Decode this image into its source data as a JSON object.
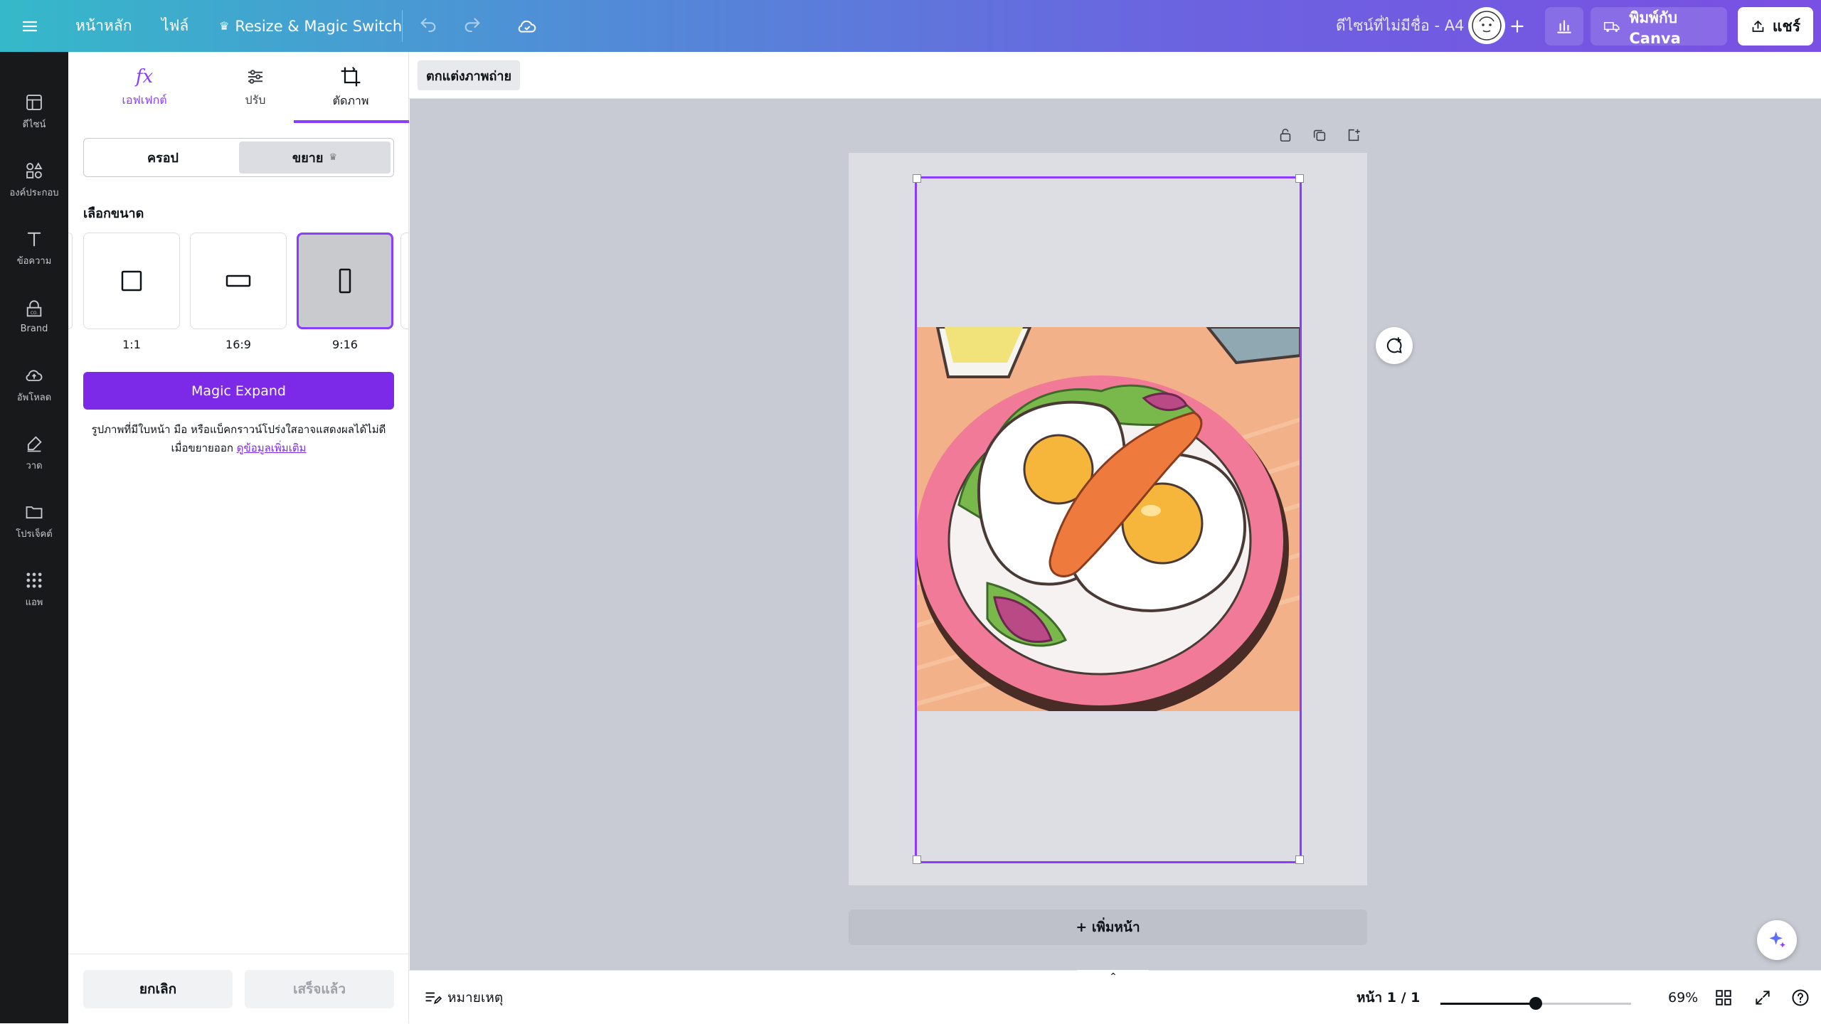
{
  "topbar": {
    "menu_icon": "hamburger-icon",
    "home": "หน้าหลัก",
    "file": "ไฟล์",
    "resize": "Resize & Magic Switch",
    "crown_icon": "crown-icon",
    "doc_title": "ดีไซน์ที่ไม่มีชื่อ - A4",
    "print": "พิมพ์กับ Canva",
    "share": "แชร์"
  },
  "rail": {
    "items": [
      {
        "label": "ดีไซน์",
        "icon": "layout-icon"
      },
      {
        "label": "องค์ประกอบ",
        "icon": "shapes-icon"
      },
      {
        "label": "ข้อความ",
        "icon": "text-icon"
      },
      {
        "label": "Brand",
        "icon": "brand-icon"
      },
      {
        "label": "อัพโหลด",
        "icon": "upload-icon"
      },
      {
        "label": "วาด",
        "icon": "draw-icon"
      },
      {
        "label": "โปรเจ็คต์",
        "icon": "folder-icon"
      },
      {
        "label": "แอพ",
        "icon": "apps-icon"
      }
    ]
  },
  "panel": {
    "tabs": [
      {
        "label": "เอฟเฟกต์",
        "icon": "fx-icon"
      },
      {
        "label": "ปรับ",
        "icon": "sliders-icon"
      },
      {
        "label": "ตัดภาพ",
        "icon": "crop-icon"
      }
    ],
    "segment": {
      "crop": "ครอป",
      "expand": "ขยาย"
    },
    "size_title": "เลือกขนาด",
    "ratios": [
      "1:1",
      "16:9",
      "9:16"
    ],
    "magic_expand": "Magic Expand",
    "note": "รูปภาพที่มีใบหน้า มือ หรือแบ็คกราวน์โปร่งใสอาจแสดงผลได้ไม่ดีเมื่อขยายออก",
    "note_link": "ดูข้อมูลเพิ่มเติม",
    "cancel": "ยกเลิก",
    "done": "เสร็จแล้ว"
  },
  "context": {
    "edit_photo": "ตกแต่งภาพถ่าย"
  },
  "canvas": {
    "add_page": "+ เพิ่มหน้า"
  },
  "bottom": {
    "notes": "หมายเหตุ",
    "page": "หน้า 1 / 1",
    "zoom": "69%",
    "zoom_value": 0.5
  },
  "colors": {
    "accent": "#8b3dff",
    "primary": "#7d2ae8"
  }
}
